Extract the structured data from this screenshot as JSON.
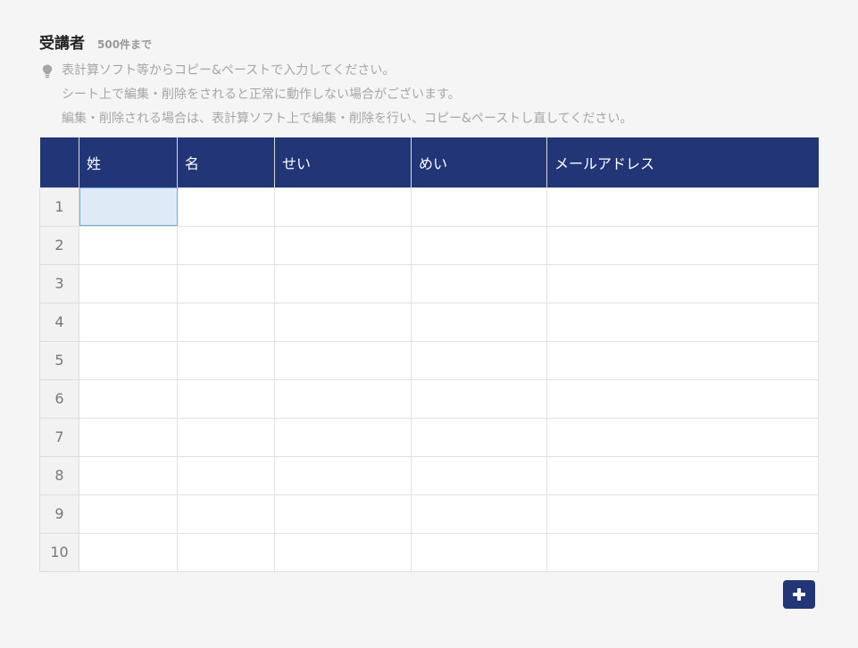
{
  "section": {
    "title": "受講者",
    "limit": "500件まで"
  },
  "hint": {
    "icon": "lightbulb-icon",
    "lines": [
      "表計算ソフト等からコピー&ペーストで入力してください。",
      "シート上で編集・削除をされると正常に動作しない場合がございます。",
      "編集・削除される場合は、表計算ソフト上で編集・削除を行い、コピー&ペーストし直してください。"
    ]
  },
  "table": {
    "columns": [
      "姓",
      "名",
      "せい",
      "めい",
      "メールアドレス"
    ],
    "row_numbers": [
      "1",
      "2",
      "3",
      "4",
      "5",
      "6",
      "7",
      "8",
      "9",
      "10"
    ],
    "rows": [
      [
        "",
        "",
        "",
        "",
        ""
      ],
      [
        "",
        "",
        "",
        "",
        ""
      ],
      [
        "",
        "",
        "",
        "",
        ""
      ],
      [
        "",
        "",
        "",
        "",
        ""
      ],
      [
        "",
        "",
        "",
        "",
        ""
      ],
      [
        "",
        "",
        "",
        "",
        ""
      ],
      [
        "",
        "",
        "",
        "",
        ""
      ],
      [
        "",
        "",
        "",
        "",
        ""
      ],
      [
        "",
        "",
        "",
        "",
        ""
      ],
      [
        "",
        "",
        "",
        "",
        ""
      ]
    ],
    "selected_cell": {
      "row": 1,
      "column": "姓"
    }
  },
  "add_button": {
    "icon": "plus-icon"
  },
  "colors": {
    "header_background": "#223577",
    "selected_cell": "#deebf7",
    "page_background": "#f5f5f5"
  }
}
